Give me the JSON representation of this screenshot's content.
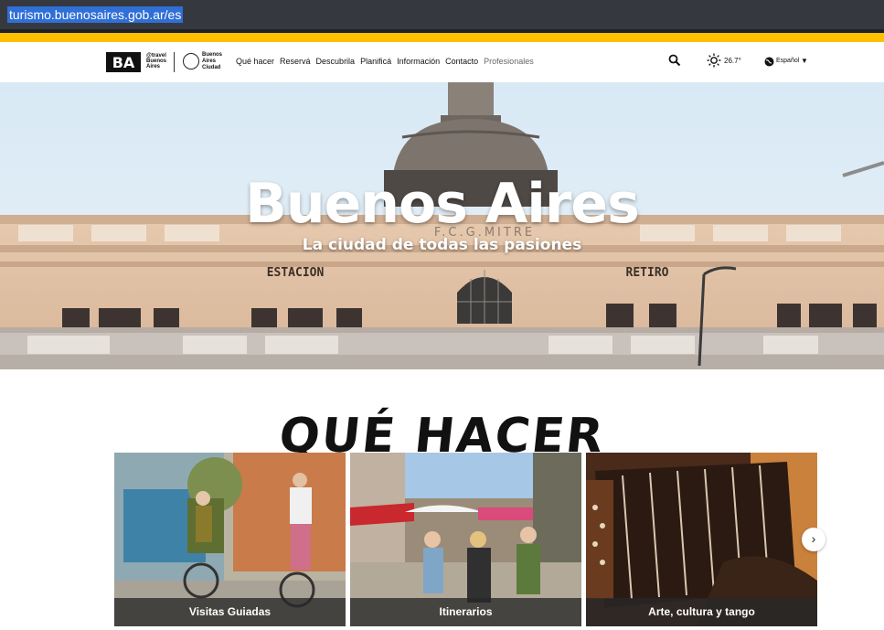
{
  "browser": {
    "url": "turismo.buenosaires.gob.ar/es"
  },
  "header": {
    "brand_travel": "@travel Buenos Aires",
    "brand_city": "Buenos Aires Ciudad",
    "nav": [
      "Qué hacer",
      "Reservá",
      "Descubrila",
      "Planificá",
      "Información",
      "Contacto",
      "Profesionales"
    ],
    "temperature": "26.7°",
    "language": "Español",
    "icons": [
      "search-icon",
      "sun-icon",
      "globe-icon"
    ]
  },
  "hero": {
    "title": "Buenos Aires",
    "subtitle": "La ciudad de todas las pasiones",
    "building_sign_left": "ESTACION",
    "building_sign_right": "RETIRO",
    "building_sign_top": "F.C.G.MITRE"
  },
  "section": {
    "title": "QUÉ HACER"
  },
  "cards": [
    {
      "label": "Visitas Guiadas"
    },
    {
      "label": "Itinerarios"
    },
    {
      "label": "Arte, cultura y tango"
    }
  ],
  "colors": {
    "accent_yellow": "#fdbf00",
    "urlbar": "#35393f",
    "label_bg": "#282828"
  }
}
